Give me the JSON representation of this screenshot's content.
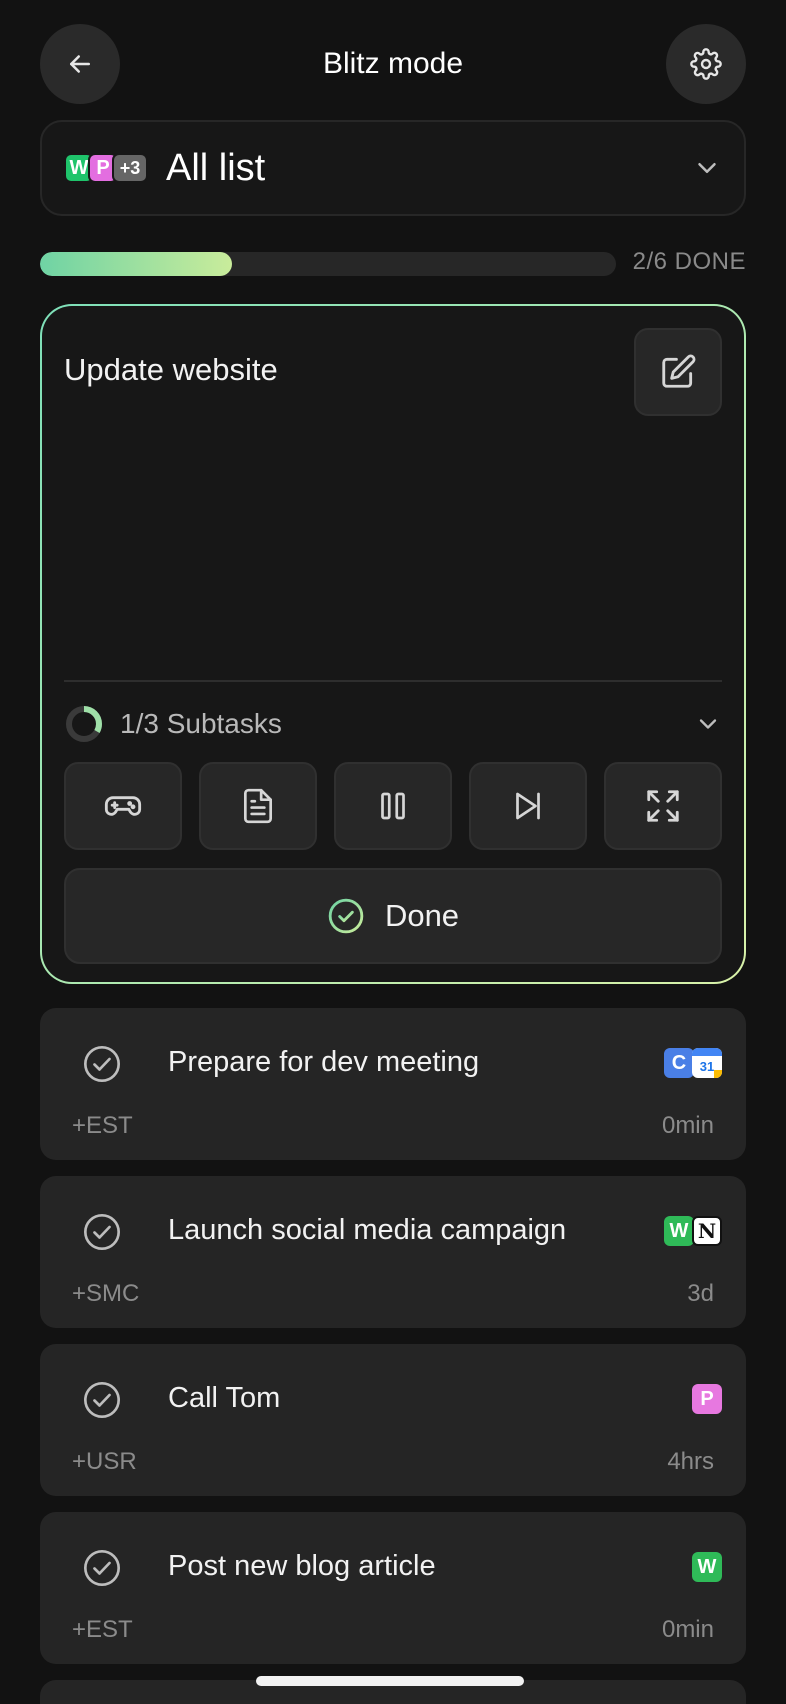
{
  "header": {
    "title": "Blitz mode",
    "back_icon": "arrow-left-icon",
    "settings_icon": "gear-icon"
  },
  "list_selector": {
    "label": "All list",
    "badges": [
      "W",
      "P",
      "+3"
    ]
  },
  "progress": {
    "done": 2,
    "total": 6,
    "label": "2/6 DONE",
    "fraction": 0.333
  },
  "current_task": {
    "title": "Update website",
    "subtasks_label": "1/3 Subtasks",
    "subtasks_fraction": 0.333,
    "actions": [
      "gamepad-icon",
      "document-icon",
      "pause-icon",
      "skip-icon",
      "expand-icon"
    ],
    "done_label": "Done"
  },
  "tasks": [
    {
      "name": "Prepare for dev meeting",
      "tag": "+EST",
      "time": "0min",
      "sources": [
        "C",
        "31"
      ]
    },
    {
      "name": "Launch social media campaign",
      "tag": "+SMC",
      "time": "3d",
      "sources": [
        "W",
        "N"
      ]
    },
    {
      "name": "Call Tom",
      "tag": "+USR",
      "time": "4hrs",
      "sources": [
        "P"
      ]
    },
    {
      "name": "Post new blog article",
      "tag": "+EST",
      "time": "0min",
      "sources": [
        "W"
      ]
    }
  ],
  "colors": {
    "accent_start": "#6fd3a4",
    "accent_end": "#c9ec9b",
    "background": "#121212",
    "card": "#252525"
  }
}
